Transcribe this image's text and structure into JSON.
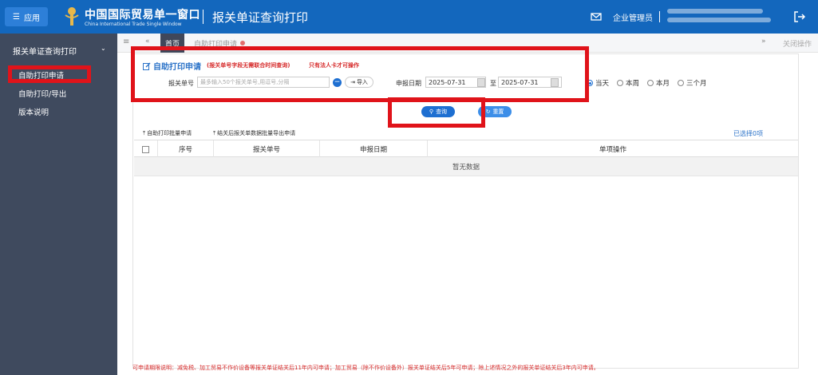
{
  "header": {
    "app_label": "应用",
    "brand_cn": "中国国际贸易单一窗口",
    "brand_en": "China International Trade Single Window",
    "title": "报关单证查询打印",
    "role": "企业管理员",
    "accent_color": "#1367bd"
  },
  "sidebar": {
    "group": "报关单证查询打印",
    "items": [
      {
        "label": "自助打印申请",
        "active": true
      },
      {
        "label": "自助打印/导出",
        "active": false
      },
      {
        "label": "版本说明",
        "active": false
      }
    ]
  },
  "tabs": {
    "home": "首页",
    "active": "自助打印申请",
    "close_ops": "关闭操作"
  },
  "form": {
    "title": "自助打印申请",
    "note": "(报关单号字段无需联合时间查询)",
    "warning": "只有法人卡才可操作",
    "decl_no_label": "报关单号",
    "decl_no_placeholder": "最多输入50个报关单号,用逗号,分隔",
    "import_label": "导入",
    "date_label": "申报日期",
    "date_from": "2025-07-31",
    "date_sep": "至",
    "date_to": "2025-07-31",
    "range_options": [
      {
        "label": "当天",
        "checked": true
      },
      {
        "label": "本周",
        "checked": false
      },
      {
        "label": "本月",
        "checked": false
      },
      {
        "label": "三个月",
        "checked": false
      }
    ],
    "query_label": "查询",
    "reset_label": "重置"
  },
  "toolbar": {
    "batch_apply": "自助打印批量申请",
    "batch_export": "结关后报关单数据批量导出申请",
    "selected": "已选择0项"
  },
  "table": {
    "columns": [
      "序号",
      "报关单号",
      "申报日期",
      "单项操作"
    ],
    "empty_text": "暂无数据"
  },
  "footer_note": "可申请期限说明：减免税、加工贸易不作价设备等报关单证结关后11年内可申请；加工贸易（除不作价设备外）报关单证结关后5年可申请；除上述情况之外的报关单证结关后3年内可申请。"
}
